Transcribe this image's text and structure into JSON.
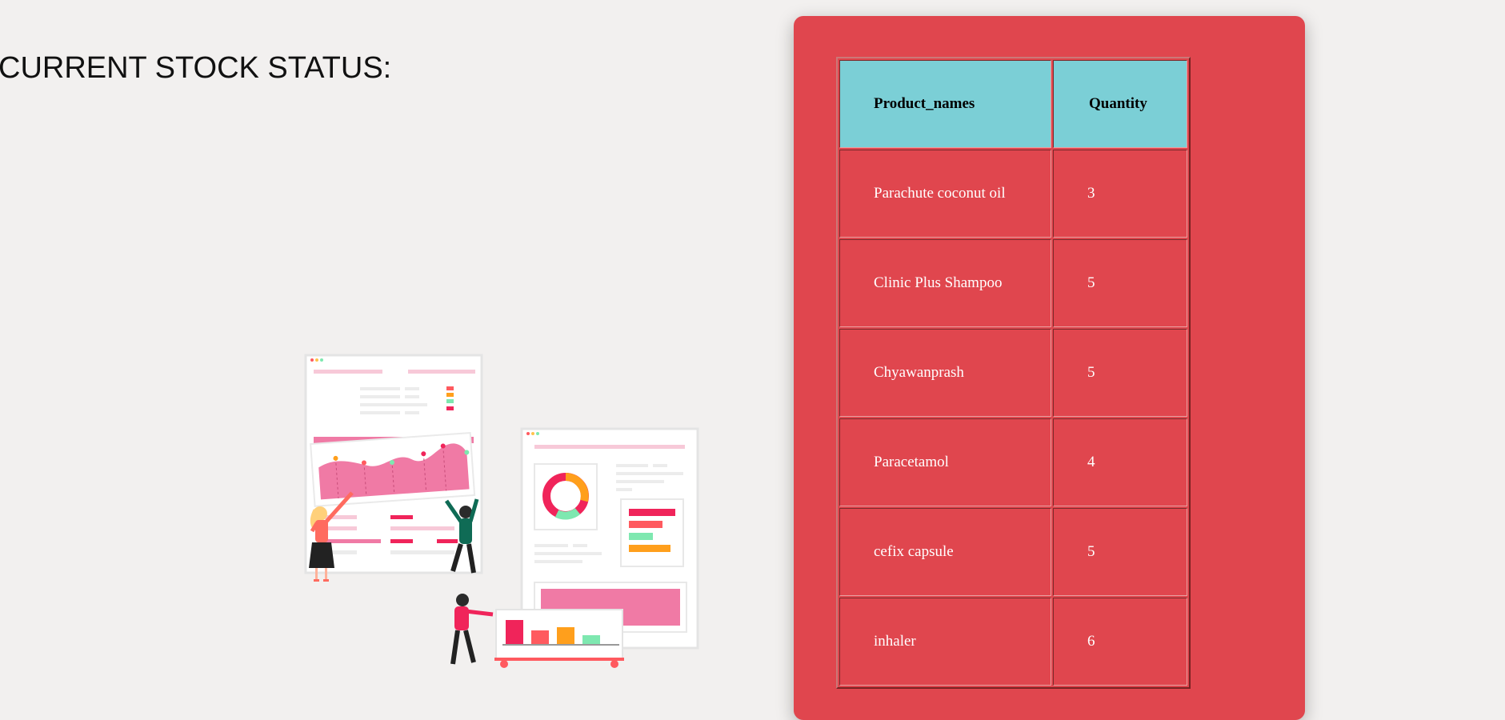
{
  "page": {
    "title": "CURRENT STOCK STATUS:"
  },
  "illustration": {
    "name": "data-dashboard-illustration",
    "colors": {
      "pink": "#f07aa5",
      "red": "#f0245a",
      "coral": "#ff5a5f",
      "orange": "#ff9f1c",
      "mint": "#7ee8b0",
      "green": "#0f6b55"
    }
  },
  "stock_table": {
    "headers": {
      "product": "Product_names",
      "quantity": "Quantity"
    },
    "rows": [
      {
        "product": "Parachute coconut oil",
        "quantity": "3"
      },
      {
        "product": "Clinic Plus Shampoo",
        "quantity": "5"
      },
      {
        "product": "Chyawanprash",
        "quantity": "5"
      },
      {
        "product": "Paracetamol",
        "quantity": "4"
      },
      {
        "product": "cefix capsule",
        "quantity": "5"
      },
      {
        "product": "inhaler",
        "quantity": "6"
      }
    ]
  },
  "colors": {
    "background": "#f2f0ef",
    "panel": "#e0464e",
    "header_cell": "#7bcfd6",
    "cell_text": "#ffffff"
  }
}
